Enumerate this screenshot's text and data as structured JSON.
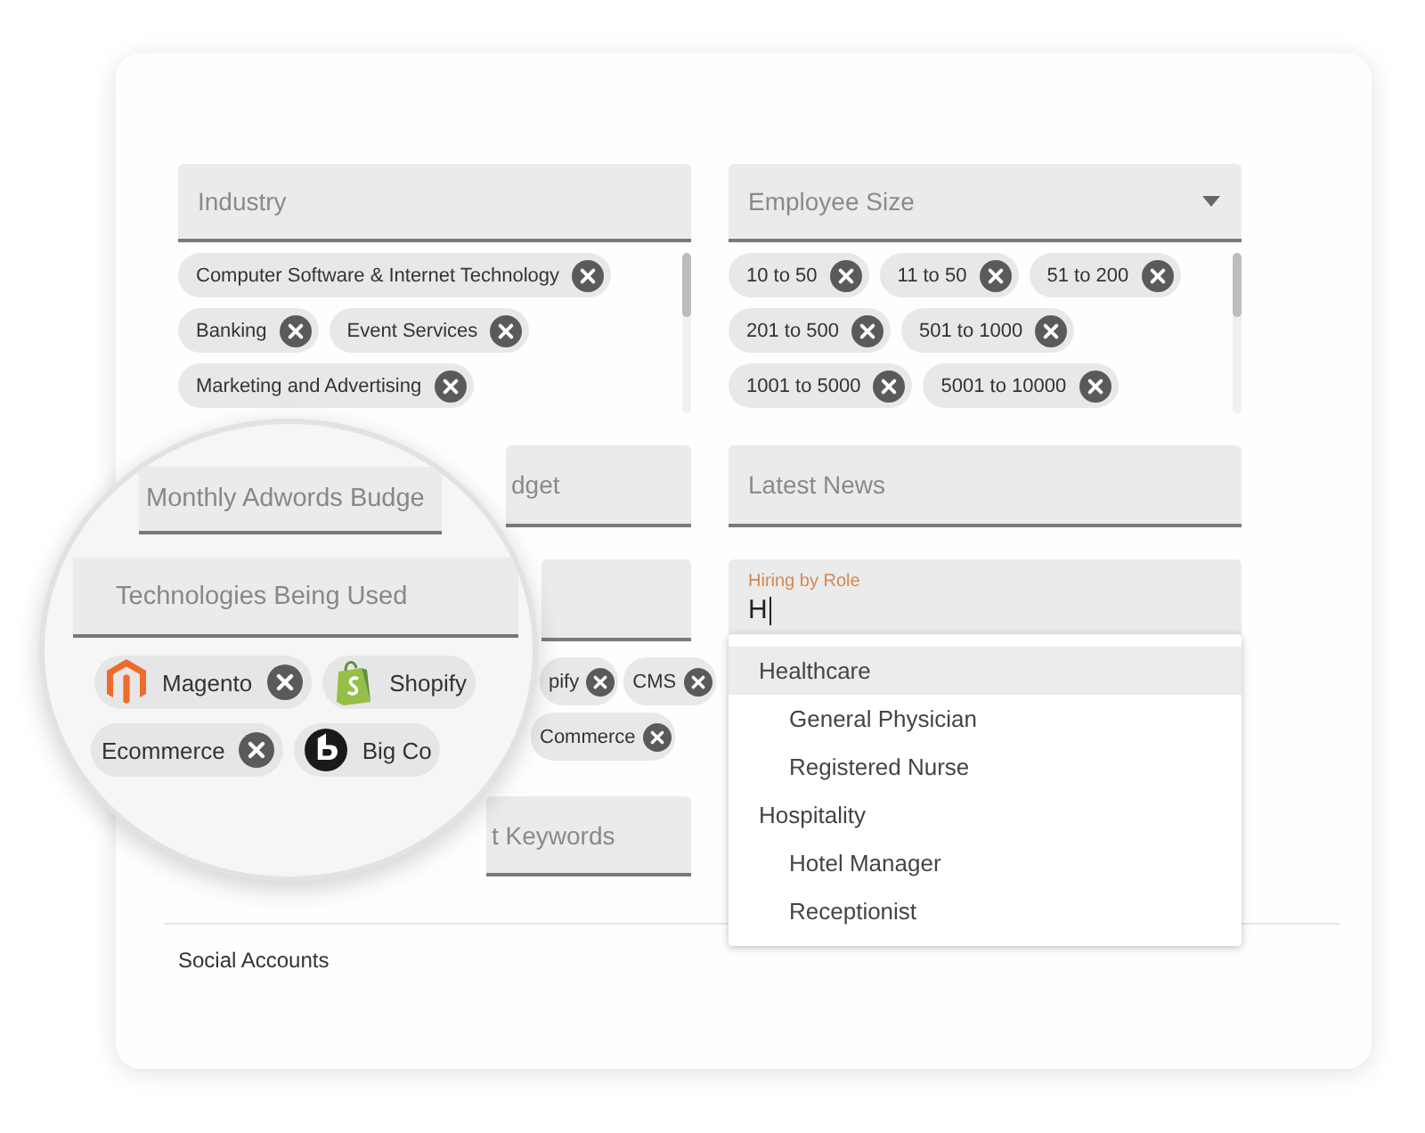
{
  "industry": {
    "label": "Industry",
    "chips": [
      {
        "text": "Computer Software & Internet Technology"
      },
      {
        "text": "Banking"
      },
      {
        "text": "Event Services"
      },
      {
        "text": "Marketing and Advertising"
      }
    ]
  },
  "employee_size": {
    "label": "Employee Size",
    "chips": [
      {
        "text": "10 to 50"
      },
      {
        "text": "11 to 50"
      },
      {
        "text": "51 to 200"
      },
      {
        "text": "201 to 500"
      },
      {
        "text": "501 to 1000"
      },
      {
        "text": "1001 to 5000"
      },
      {
        "text": "5001 to 10000"
      }
    ]
  },
  "monthly_adwords_budget": {
    "label": "dget"
  },
  "latest_news": {
    "label": "Latest News"
  },
  "technologies_chips": [
    [
      {
        "text": "pify"
      },
      {
        "text": "CMS"
      }
    ],
    [
      {
        "text": "Commerce"
      }
    ]
  ],
  "hiring_by_role": {
    "label": "Hiring by Role",
    "value": "H",
    "focused": true
  },
  "role_options": [
    {
      "text": "Healthcare",
      "kind": "group",
      "selected": true
    },
    {
      "text": "General Physician",
      "kind": "item",
      "selected": false
    },
    {
      "text": "Registered Nurse",
      "kind": "item",
      "selected": false
    },
    {
      "text": "Hospitality",
      "kind": "group",
      "selected": false
    },
    {
      "text": "Hotel Manager",
      "kind": "item",
      "selected": false
    },
    {
      "text": "Receptionist",
      "kind": "item",
      "selected": false
    }
  ],
  "keywords": {
    "label": "t Keywords"
  },
  "section": "Social Accounts",
  "magnifier": {
    "fields": [
      {
        "label": "Monthly Adwords Budge"
      },
      {
        "label": "Technologies Being Used"
      }
    ],
    "chip_rows": [
      [
        {
          "text": "Magento",
          "kind": "hexagon",
          "removable": true
        },
        {
          "text": "Shopify",
          "kind": "bag",
          "removable": false
        }
      ],
      [
        {
          "text": "Ecommerce",
          "kind": "plain",
          "removable": true
        },
        {
          "text": "Big Co",
          "kind": "round",
          "removable": false
        }
      ]
    ]
  }
}
